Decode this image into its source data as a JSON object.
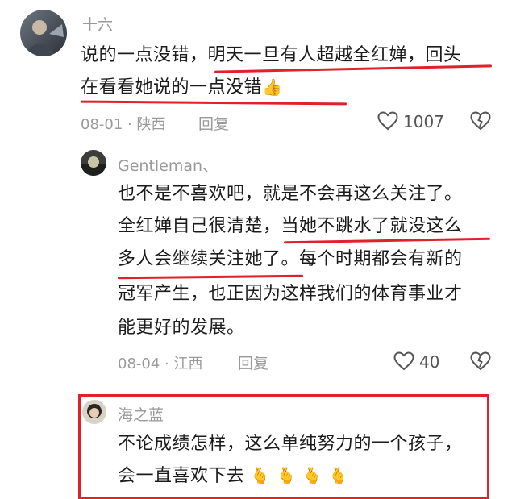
{
  "comment1": {
    "username": "十六",
    "line1_a": "说的一点没错，",
    "line1_b": "明天一旦有人超越全红婵，回头",
    "line2": "在看看她说的一点没错",
    "emoji_icon": "thumbs-up-icon",
    "date": "08-01",
    "location": "陕西",
    "reply_label": "回复",
    "likes": "1007"
  },
  "comment2": {
    "username": "Gentleman、",
    "line1": "也不是不喜欢吧，就是不会再这么关注了。",
    "line2_a": "全红婵自己很清楚，",
    "line2_b": "当她不跳水了就没这么",
    "line3_a": "多人会继续关注她了。",
    "line3_b": "每个时期都会有新的",
    "line4": "冠军产生，也正因为这样我们的体育事业才",
    "line5": "能更好的发展。",
    "date": "08-04",
    "location": "江西",
    "reply_label": "回复",
    "likes": "40"
  },
  "comment3": {
    "username": "海之蓝",
    "line1": "不论成绩怎样，这么单纯努力的一个孩子，",
    "line2": "会一直喜欢下去",
    "emoji_icon": "finger-heart-icon"
  },
  "colors": {
    "highlight": "#e0202a",
    "meta_gray": "#9a9a9a"
  }
}
